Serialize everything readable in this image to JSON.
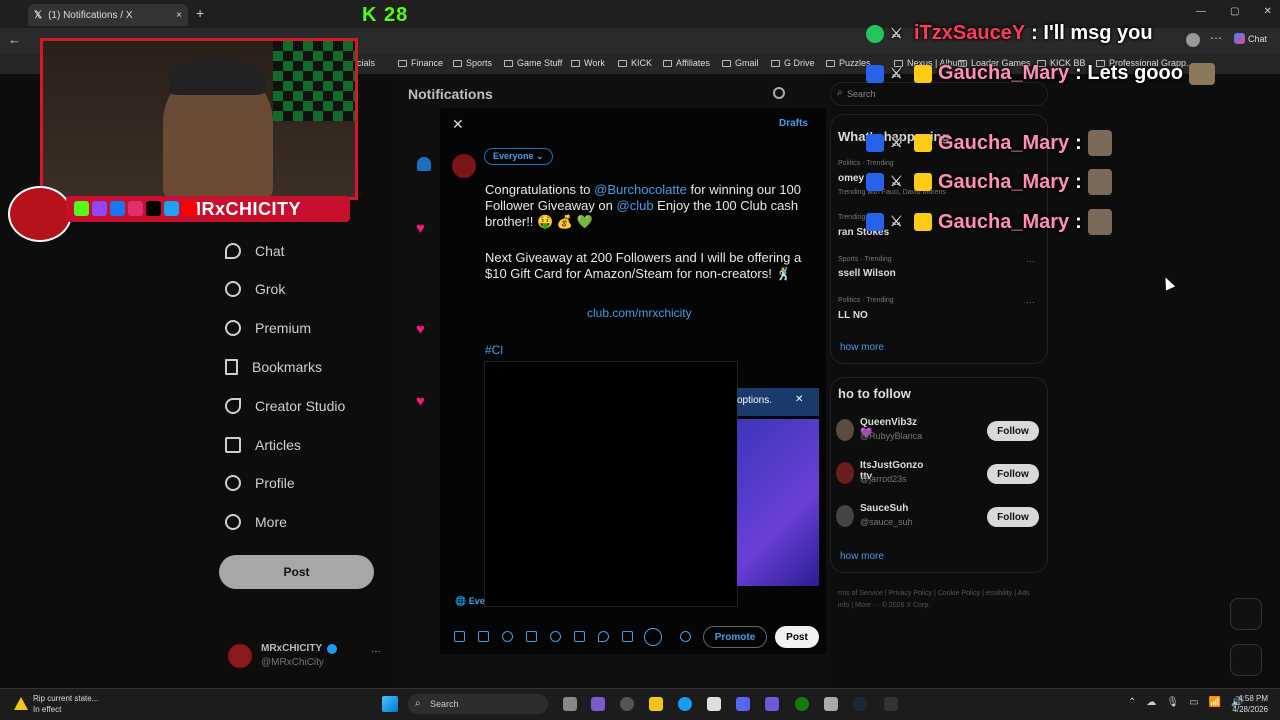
{
  "browser": {
    "tab_title": "(1) Notifications / X",
    "bookmarks": [
      "Socials",
      "Finance",
      "Sports",
      "Game Stuff",
      "Work",
      "KICK",
      "Affiliates",
      "Gmail",
      "G Drive",
      "Puzzles",
      "Nexus | Album",
      "Loader Games",
      "KICK BB",
      "Professional Grapp..."
    ],
    "chat_button": "Chat"
  },
  "overlay": {
    "kick_logo": "K 28",
    "streamer_name": "MRxCHICITY"
  },
  "nav": {
    "items": [
      "Chat",
      "Grok",
      "Premium",
      "Bookmarks",
      "Creator Studio",
      "Articles",
      "Profile",
      "More"
    ],
    "post_label": "Post",
    "account_name": "MRxCHICITY",
    "account_handle": "@MRxChiCity"
  },
  "center": {
    "title": "Notifications"
  },
  "compose": {
    "audience": "Everyone",
    "drafts": "Drafts",
    "line1_pre": "Congratulations to ",
    "mention1": "@Burchocolatte",
    "line1_mid": " for winning our 100 Follower Giveaway on ",
    "mention2": "@club",
    "line1_post": " Enjoy the 100 Club cash brother!! 🤑 💰 💚",
    "line2": "Next Giveaway at 200 Followers and I will be offering a $10 Gift Card for Amazon/Steam for non-creators! 🕺",
    "link": "club.com/mrxchicity",
    "hashtag": "#Cl",
    "promo_text": "options.",
    "everyone_footer": "Eve",
    "promote": "Promote",
    "post": "Post"
  },
  "right": {
    "search_placeholder": "Search",
    "whats_happening": "What's happening",
    "trends": [
      {
        "cat": "Politics · Trending",
        "name": "omey",
        "sub": "Trending with Fauci, David Morens"
      },
      {
        "cat": "Trending",
        "name": "ran Stokes",
        "sub": ""
      },
      {
        "cat": "Sports · Trending",
        "name": "ssell Wilson",
        "sub": ""
      },
      {
        "cat": "Politics · Trending",
        "name": "LL NO",
        "sub": ""
      }
    ],
    "show_more": "how more",
    "who_to_follow": "ho to follow",
    "follow_list": [
      {
        "name": "QueenVib3z 💜",
        "handle": "@RubyyBlanca",
        "btn": "Follow"
      },
      {
        "name": "ItsJustGonzo ttv",
        "handle": "@jarrod23s",
        "btn": "Follow"
      },
      {
        "name": "SauceSuh",
        "handle": "@sauce_suh",
        "btn": "Follow"
      }
    ],
    "show_more2": "how more",
    "footer": "rms of Service  |  Privacy Policy  |  Cookie Policy  |  essibility  |  Ads info  |  More ···  © 2026 X Corp."
  },
  "chat_overlay": [
    {
      "user": "iTzxSauceY",
      "msg": ": I'll msg you",
      "color": "#ff3a5a"
    },
    {
      "user": "Gaucha_Mary",
      "msg": ": Lets gooo",
      "color": "#ff8fb4"
    },
    {
      "user": "Gaucha_Mary",
      "msg": ":",
      "color": "#ff8fb4"
    },
    {
      "user": "Gaucha_Mary",
      "msg": ":",
      "color": "#ff8fb4"
    },
    {
      "user": "Gaucha_Mary",
      "msg": ":",
      "color": "#ff8fb4"
    }
  ],
  "taskbar": {
    "notification_title": "Rip current state...",
    "notification_sub": "In effect",
    "search": "Search",
    "time": "4:58 PM",
    "date": "4/28/2026"
  }
}
